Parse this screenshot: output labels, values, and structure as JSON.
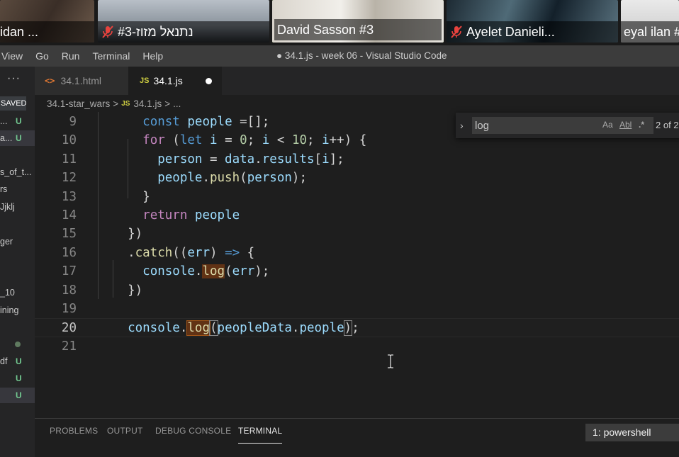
{
  "participants": [
    {
      "name": "idan ...",
      "muted": false
    },
    {
      "name": "#3-נתנאל מזוז",
      "muted": true
    },
    {
      "name": "David Sasson #3",
      "muted": false,
      "active": true
    },
    {
      "name": "Ayelet Danieli...",
      "muted": true
    },
    {
      "name": "eyal ilan #",
      "muted": false
    }
  ],
  "menu": [
    "View",
    "Go",
    "Run",
    "Terminal",
    "Help"
  ],
  "window_title": "● 34.1.js - week 06 - Visual Studio Code",
  "sidebar": {
    "more": "···",
    "unsaved_label": "SAVED",
    "rows": [
      {
        "text": "...",
        "status": "U"
      },
      {
        "text": "a...",
        "status": "U"
      },
      {
        "text": "s_of_t...",
        "status": ""
      },
      {
        "text": "rs",
        "status": ""
      },
      {
        "text": "Jjklj",
        "status": ""
      },
      {
        "text": "ger",
        "status": ""
      },
      {
        "text": "_10",
        "status": ""
      },
      {
        "text": "ining",
        "status": ""
      },
      {
        "text": "df",
        "status": "U"
      },
      {
        "text": "",
        "status": "U"
      },
      {
        "text": "",
        "status": "U"
      }
    ]
  },
  "tabs": [
    {
      "label": "34.1.html",
      "icon": "html-icon"
    },
    {
      "label": "34.1.js",
      "icon": "js-icon",
      "icon_text": "JS",
      "dirty": true
    }
  ],
  "breadcrumb": {
    "folder": "34.1-star_wars",
    "file": "34.1.js",
    "symbol": "...",
    "sep": ">"
  },
  "find": {
    "value": "log",
    "match_case": "Aa",
    "whole_word": "Abl",
    "regex": ".*",
    "count": "2 of 2"
  },
  "code": {
    "current_line": 20,
    "line_numbers": [
      "9",
      "10",
      "11",
      "12",
      "13",
      "14",
      "15",
      "16",
      "17",
      "18",
      "19",
      "20",
      "21"
    ],
    "lines": [
      "    const people =[];",
      "    for (let i = 0; i < 10; i++) {",
      "      person = data.results[i];",
      "      people.push(person);",
      "    }",
      "    return people",
      "  })",
      "  .catch((err) => {",
      "    console.log(err);",
      "  })",
      "",
      "  console.log(peopleData.people);",
      ""
    ]
  },
  "panel": {
    "tabs": [
      "PROBLEMS",
      "OUTPUT",
      "DEBUG CONSOLE",
      "TERMINAL"
    ],
    "active_tab": "TERMINAL",
    "terminal_select": "1: powershell"
  },
  "colors": {
    "accent_active_speaker": "#7ac143",
    "mic_off": "#e8433e",
    "untracked": "#73c991"
  }
}
